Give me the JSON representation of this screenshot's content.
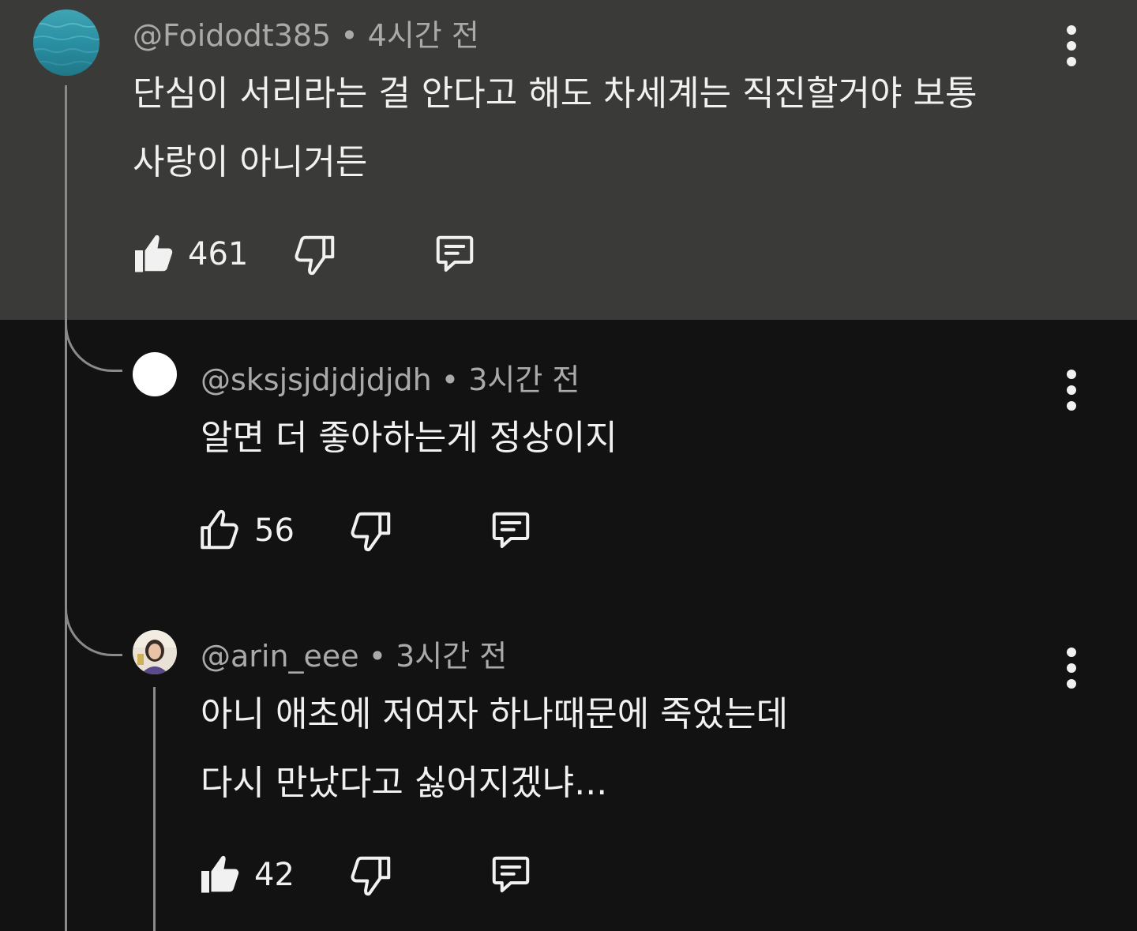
{
  "comments": [
    {
      "username": "@Foidodt385",
      "separator": "•",
      "time": "4시간 전",
      "lines": [
        "단심이 서리라는 걸 안다고 해도 차세계는 직진할거야 보통",
        "사랑이 아니거든"
      ],
      "likes": "461",
      "liked": true,
      "highlighted": true,
      "avatar": "ocean-photo"
    },
    {
      "username": "@sksjsjdjdjdjdh",
      "separator": "•",
      "time": "3시간 전",
      "lines": [
        "알면 더 좋아하는게 정상이지"
      ],
      "likes": "56",
      "liked": false,
      "avatar": "white-circle"
    },
    {
      "username": "@arin_eee",
      "separator": "•",
      "time": "3시간 전",
      "lines": [
        "아니 애초에 저여자 하나때문에 죽었는데",
        "다시 만났다고 싫어지겠냐..."
      ],
      "likes": "42",
      "liked": true,
      "avatar": "person-photo"
    }
  ],
  "colors": {
    "highlight_bg": "#3a3b39",
    "page_bg": "#121212",
    "meta_text": "#aaaaaa",
    "body_text": "#f1f1f1",
    "thread_line": "#8a8a8a"
  },
  "icons": [
    "thumbs-up-icon",
    "thumbs-down-icon",
    "reply-comment-icon",
    "more-vert-icon"
  ]
}
